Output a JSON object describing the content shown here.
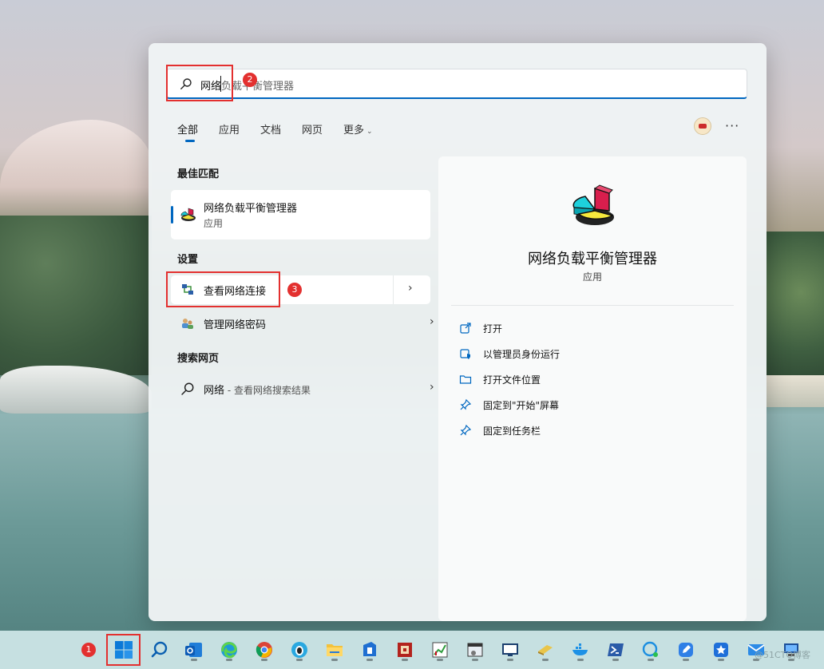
{
  "search": {
    "typed": "网络",
    "suggestion": "负载平衡管理器"
  },
  "tabs": [
    {
      "label": "全部",
      "active": true
    },
    {
      "label": "应用"
    },
    {
      "label": "文档"
    },
    {
      "label": "网页"
    },
    {
      "label": "更多"
    }
  ],
  "sections": {
    "best_match": "最佳匹配",
    "settings": "设置",
    "web_search": "搜索网页"
  },
  "best_match": {
    "title": "网络负载平衡管理器",
    "subtitle": "应用"
  },
  "settings": [
    {
      "label": "查看网络连接"
    },
    {
      "label": "管理网络密码"
    }
  ],
  "web_result": {
    "query": "网络",
    "suffix": " - 查看网络搜索结果"
  },
  "detail": {
    "title": "网络负载平衡管理器",
    "subtitle": "应用",
    "actions": [
      {
        "label": "打开",
        "icon": "open-external-icon"
      },
      {
        "label": "以管理员身份运行",
        "icon": "admin-shield-icon"
      },
      {
        "label": "打开文件位置",
        "icon": "folder-icon"
      },
      {
        "label": "固定到\"开始\"屏幕",
        "icon": "pin-icon"
      },
      {
        "label": "固定到任务栏",
        "icon": "pin-icon"
      }
    ]
  },
  "annotations": [
    "1",
    "2",
    "3"
  ],
  "taskbar": {
    "items": [
      "start-button",
      "search",
      "outlook",
      "edge",
      "chrome",
      "qq",
      "file-explorer",
      "app-blue",
      "app-red",
      "app-chart",
      "app-window",
      "remote-desktop",
      "app-yellow",
      "docker",
      "powershell",
      "app-chat",
      "app-edit",
      "app-star",
      "app-mail",
      "app-monitor"
    ]
  },
  "watermark": "@51CTO博客",
  "colors": {
    "accent": "#0067c0",
    "annotation_red": "#e3302f"
  }
}
